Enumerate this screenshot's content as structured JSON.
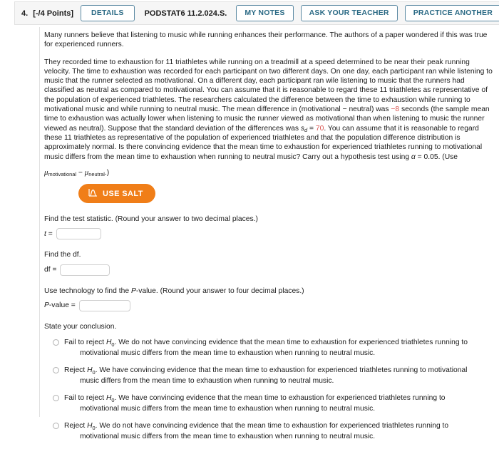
{
  "header": {
    "question_number": "4.",
    "points": "[-/4 Points]",
    "details_label": "DETAILS",
    "assignment_code": "PODSTAT6 11.2.024.S.",
    "my_notes_label": "MY NOTES",
    "ask_teacher_label": "ASK YOUR TEACHER",
    "practice_another_label": "PRACTICE ANOTHER",
    "accent_color": "#2b6a85",
    "panel_bg": "#f6f6f6"
  },
  "problem": {
    "paragraph_1": "Many runners believe that listening to music while running enhances their performance. The authors of a paper wondered if this was true for experienced runners.",
    "paragraph_2_part_1": "They recorded time to exhaustion for 11 triathletes while running on a treadmill at a speed determined to be near their peak running velocity. The time to exhaustion was recorded for each participant on two different days. On one day, each participant ran while listening to music that the runner selected as motivational. On a different day, each participant ran wile listening to music that the runners had classified as neutral as compared to motivational. You can assume that it is reasonable to regard these 11 triathletes as representative of the population of experienced triathletes. The researchers calculated the difference between the time to exhaustion while running to motivational music and while running to neutral music. The mean difference in (motivational ",
    "minus_sign": "−",
    "paragraph_2_part_2": " neutral) was ",
    "mean_difference": "−8",
    "paragraph_2_part_3": " seconds (the sample mean time to exhaustion was actually lower when listening to music the runner viewed as motivational than when listening to music the runner viewed as neutral). Suppose that the standard deviation of the differences was ",
    "sd_symbol": "s",
    "sd_subscript": "d",
    "sd_equals": " = ",
    "sd_value": "70",
    "paragraph_2_part_4": ". You can assume that it is reasonable to regard these 11 triathletes as representative of the population of experienced triathletes and that the population difference distribution is approximately normal. Is there convincing evidence that the mean time to exhaustion for experienced triathletes running to motivational music differs from the mean time to exhaustion when running to neutral music? Carry out a hypothesis test using ",
    "alpha_symbol": "α",
    "alpha_equals": " = 0.05. (Use",
    "mu_symbol": "μ",
    "mu_sub_1": "motivational",
    "mu_minus": " − ",
    "mu_sub_2": "neutral",
    "mu_close": ".)",
    "highlight_color": "#d9534f"
  },
  "salt": {
    "label": "USE SALT",
    "icon": "distribution-curve-icon",
    "bg_color": "#f07e18",
    "text_color": "#ffffff"
  },
  "questions": {
    "test_statistic": {
      "prompt": "Find the test statistic. (Round your answer to two decimal places.)",
      "label_symbol": "t",
      "label_equals": " =",
      "value": "",
      "placeholder": ""
    },
    "df": {
      "prompt": "Find the df.",
      "label": "df =",
      "value": "",
      "placeholder": ""
    },
    "pvalue": {
      "prompt_part_1": "Use technology to find the ",
      "prompt_italic": "P",
      "prompt_part_2": "-value. (Round your answer to four decimal places.)",
      "label_italic": "P",
      "label_rest": "-value =",
      "value": "",
      "placeholder": ""
    }
  },
  "conclusion": {
    "prompt": "State your conclusion.",
    "options": [
      {
        "decision": "Fail to reject ",
        "h_symbol": "H",
        "h_sub": "0",
        "line_1": ". We do not have convincing evidence that the mean time to exhaustion for experienced triathletes running to",
        "line_2": "motivational music differs from the mean time to exhaustion when running to neutral music.",
        "selected": false
      },
      {
        "decision": "Reject ",
        "h_symbol": "H",
        "h_sub": "0",
        "line_1": ". We have convincing evidence that the mean time to exhaustion for experienced triathletes running to motivational",
        "line_2": "music differs from the mean time to exhaustion when running to neutral music.",
        "selected": false
      },
      {
        "decision": "Fail to reject ",
        "h_symbol": "H",
        "h_sub": "0",
        "line_1": ". We have convincing evidence that the mean time to exhaustion for experienced triathletes running to",
        "line_2": "motivational music differs from the mean time to exhaustion when running to neutral music.",
        "selected": false
      },
      {
        "decision": "Reject ",
        "h_symbol": "H",
        "h_sub": "0",
        "line_1": ". We do not have convincing evidence that the mean time to exhaustion for experienced triathletes running to",
        "line_2": "motivational music differs from the mean time to exhaustion when running to neutral music.",
        "selected": false
      }
    ]
  }
}
